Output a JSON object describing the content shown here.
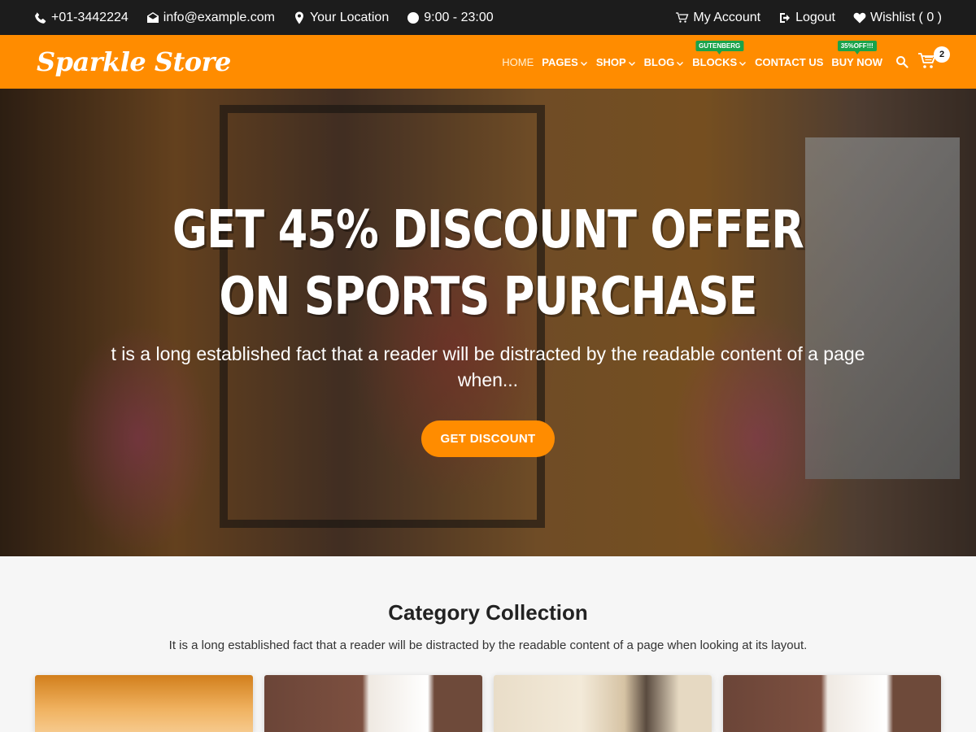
{
  "topbar": {
    "phone": "+01-3442224",
    "email": "info@example.com",
    "location": "Your Location",
    "hours": "9:00 - 23:00",
    "account": "My Account",
    "logout": "Logout",
    "wishlist": "Wishlist ( 0 )"
  },
  "header": {
    "logo": "Sparkle Store",
    "nav": [
      {
        "label": "HOME"
      },
      {
        "label": "PAGES"
      },
      {
        "label": "SHOP"
      },
      {
        "label": "BLOG"
      },
      {
        "label": "BLOCKS",
        "badge": "GUTENBERG"
      },
      {
        "label": "CONTACT US"
      },
      {
        "label": "BUY NOW",
        "badge": "35%OFF!!!"
      }
    ],
    "cart_count": "2"
  },
  "hero": {
    "title": "GET 45% DISCOUNT OFFER ON SPORTS PURCHASE",
    "text": "t is a long established fact that a reader will be distracted by the readable content of a page when...",
    "button": "GET DISCOUNT"
  },
  "category": {
    "title": "Category Collection",
    "subtitle": "It is a long established fact that a reader will be distracted by the readable content of a page when looking at its layout."
  },
  "colors": {
    "accent": "#ff8c00",
    "topbar": "#1c1c1c",
    "badge": "#1aa34a"
  }
}
